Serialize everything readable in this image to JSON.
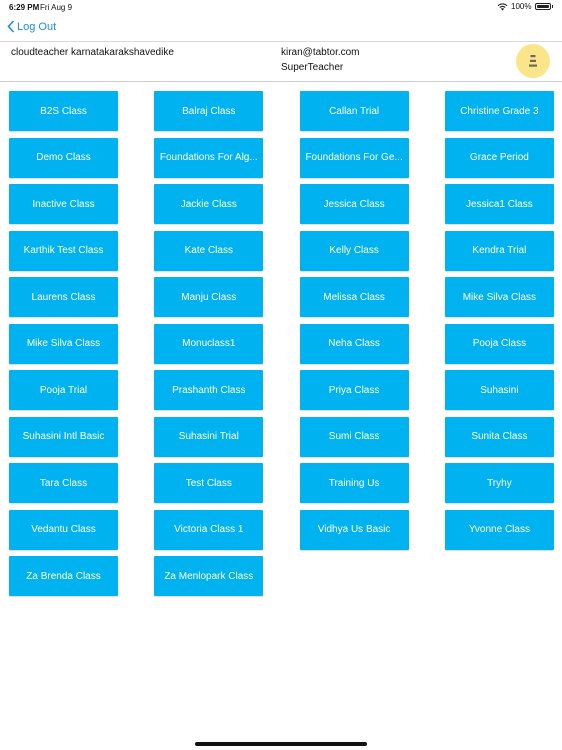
{
  "status_bar": {
    "time": "6:29 PM",
    "date": "Fri Aug 9",
    "battery": "100%"
  },
  "nav": {
    "logout_label": "Log Out"
  },
  "header": {
    "school_name": "cloudteacher karnatakarakshavedike",
    "email": "kiran@tabtor.com",
    "role": "SuperTeacher"
  },
  "colors": {
    "accent": "#00b3f0",
    "link": "#1a8cf0",
    "menu_button": "#fbe58a"
  },
  "classes": [
    "B2S Class",
    "Balraj Class",
    "Callan Trial",
    "Christine Grade 3",
    "Demo Class",
    "Foundations For Alg...",
    "Foundations For Ge...",
    "Grace Period",
    "Inactive Class",
    "Jackie Class",
    "Jessica Class",
    "Jessica1 Class",
    "Karthik Test Class",
    "Kate Class",
    "Kelly Class",
    "Kendra Trial",
    "Laurens Class",
    "Manju Class",
    "Melissa Class",
    "Mike Silva Class",
    "Mike Silva Class",
    "Monuclass1",
    "Neha Class",
    "Pooja Class",
    "Pooja Trial",
    "Prashanth Class",
    "Priya Class",
    "Suhasini",
    "Suhasini Intl Basic",
    "Suhasini Trial",
    "Sumi Class",
    "Sunita Class",
    "Tara Class",
    "Test Class",
    "Training Us",
    "Tryhy",
    "Vedantu Class",
    "Victoria Class 1",
    "Vidhya Us Basic",
    "Yvonne Class",
    "Za Brenda Class",
    "Za Menlopark Class"
  ]
}
